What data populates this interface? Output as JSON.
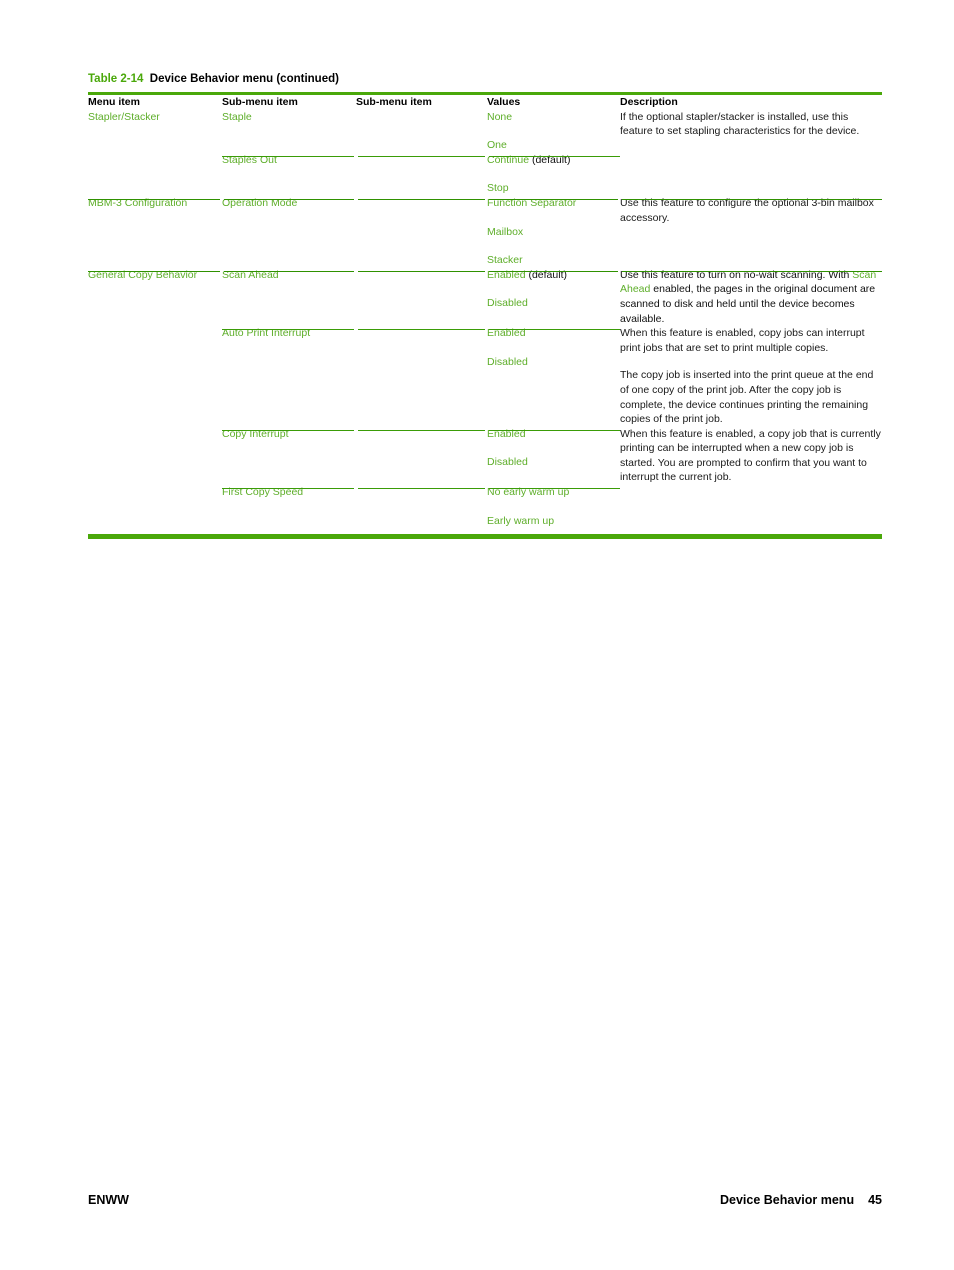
{
  "document": {
    "caption_number": "Table 2-14",
    "caption_title": "Device Behavior menu (continued)",
    "accent_color": "#4aa80a",
    "link_color": "#5eae2a"
  },
  "table": {
    "headers": {
      "menu_item": "Menu item",
      "sub_menu_item_1": "Sub-menu item",
      "sub_menu_item_2": "Sub-menu item",
      "values": "Values",
      "description": "Description"
    },
    "rows": [
      {
        "menu_item": "Stapler/Stacker",
        "sub_rows": [
          {
            "sub_menu_item": "Staple",
            "values": [
              "None",
              "One"
            ],
            "description_parts": [
              "If the optional stapler/stacker is installed, use this feature to set stapling characteristics for the device."
            ]
          },
          {
            "sub_menu_item": "Staples Out",
            "values": [
              "Continue",
              "Stop"
            ],
            "value_suffix_0": " (default)",
            "description_parts": []
          }
        ]
      },
      {
        "menu_item": "MBM-3 Configuration",
        "sub_rows": [
          {
            "sub_menu_item": "Operation Mode",
            "values": [
              "Function Separator",
              "Mailbox",
              "Stacker"
            ],
            "description_parts": [
              "Use this feature to configure the optional 3-bin mailbox accessory."
            ]
          }
        ]
      },
      {
        "menu_item": "General Copy Behavior",
        "sub_rows": [
          {
            "sub_menu_item": "Scan Ahead",
            "values": [
              "Enabled",
              "Disabled"
            ],
            "value_suffix_0": " (default)",
            "description_segments": [
              {
                "text": "Use this feature to turn on no-wait scanning. With ",
                "style": "black"
              },
              {
                "text": "Scan Ahead",
                "style": "green"
              },
              {
                "text": " enabled, the pages in the original document are scanned to disk and held until the device becomes available.",
                "style": "black"
              }
            ]
          },
          {
            "sub_menu_item": "Auto Print Interrupt",
            "values": [
              "Enabled",
              "Disabled"
            ],
            "description_parts": [
              "When this feature is enabled, copy jobs can interrupt print jobs that are set to print multiple copies.",
              "The copy job is inserted into the print queue at the end of one copy of the print job. After the copy job is complete, the device continues printing the remaining copies of the print job."
            ]
          },
          {
            "sub_menu_item": "Copy Interrupt",
            "values": [
              "Enabled",
              "Disabled"
            ],
            "description_parts": [
              "When this feature is enabled, a copy job that is currently printing can be interrupted when a new copy job is started. You are prompted to confirm that you want to interrupt the current job."
            ]
          },
          {
            "sub_menu_item": "First Copy Speed",
            "values": [
              "No early warm up",
              "Early warm up"
            ],
            "description_parts": []
          }
        ]
      }
    ]
  },
  "footer": {
    "left": "ENWW",
    "section": "Device Behavior menu",
    "page_number": "45"
  }
}
